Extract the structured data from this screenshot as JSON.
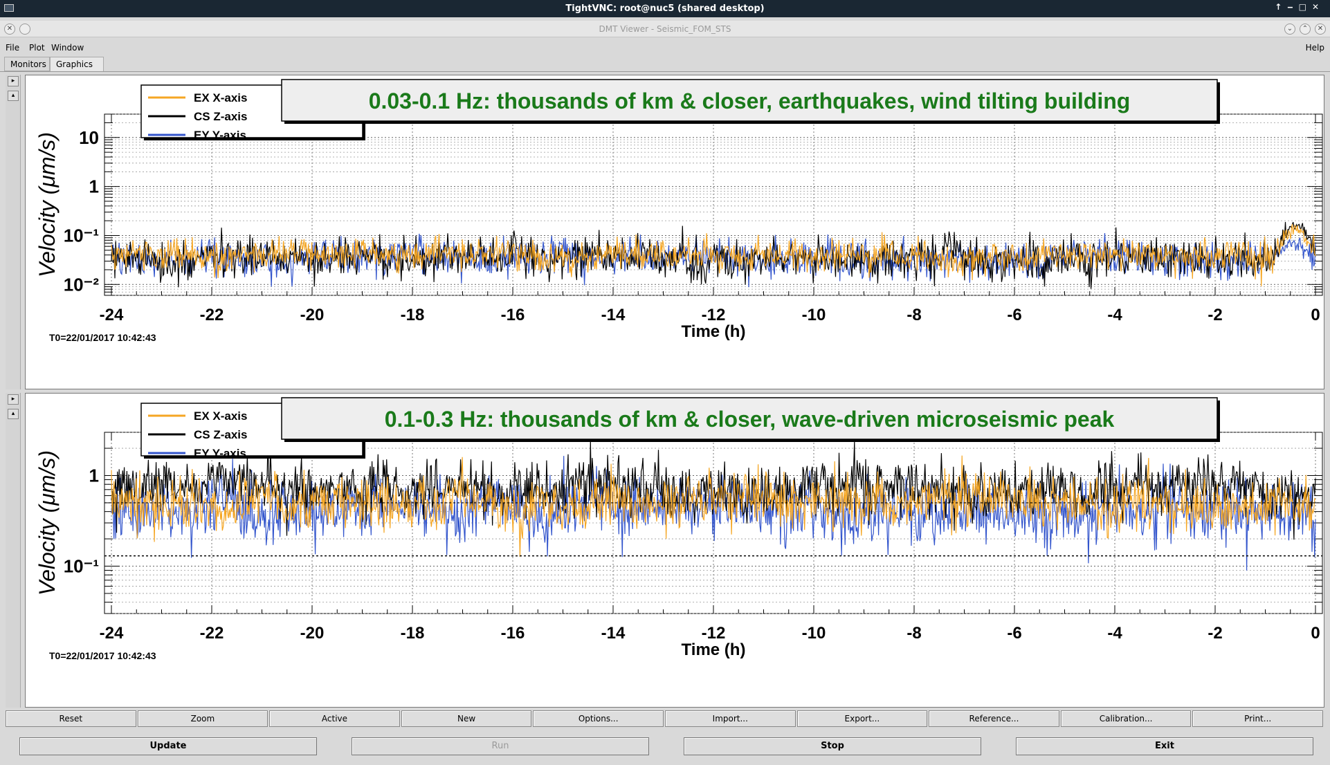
{
  "vnc_title": "TightVNC: root@nuc5 (shared desktop)",
  "app_title": "DMT Viewer - Seismic_FOM_STS",
  "menu": {
    "file": "File",
    "plot": "Plot",
    "window": "Window",
    "help": "Help"
  },
  "tabs": [
    "Monitors",
    "Graphics"
  ],
  "plots": [
    {
      "title": "0.03-0.1 Hz: thousands of km & closer, earthquakes, wind tilting building",
      "ylabel": "Velocity  (μm/s)",
      "xlabel": "Time (h)",
      "t0": "T0=22/01/2017 10:42:43",
      "legend": [
        "EX X-axis",
        "CS Z-axis",
        "EY Y-axis"
      ],
      "yticks": [
        "10",
        "1",
        "10⁻¹",
        "10⁻²"
      ],
      "xticks": [
        "-24",
        "-22",
        "-20",
        "-18",
        "-16",
        "-14",
        "-12",
        "-10",
        "-8",
        "-6",
        "-4",
        "-2",
        "0"
      ]
    },
    {
      "title": "0.1-0.3 Hz: thousands of km & closer, wave-driven microseismic peak",
      "ylabel": "Velocity  (μm/s)",
      "xlabel": "Time (h)",
      "t0": "T0=22/01/2017 10:42:43",
      "legend": [
        "EX X-axis",
        "CS Z-axis",
        "EY Y-axis"
      ],
      "yticks": [
        "1",
        "10⁻¹"
      ],
      "xticks": [
        "-24",
        "-22",
        "-20",
        "-18",
        "-16",
        "-14",
        "-12",
        "-10",
        "-8",
        "-6",
        "-4",
        "-2",
        "0"
      ]
    }
  ],
  "series_colors": {
    "ex": "#f5a623",
    "cs": "#000000",
    "ey": "#3355cc"
  },
  "buttons_row1": [
    "Reset",
    "Zoom",
    "Active",
    "New",
    "Options...",
    "Import...",
    "Export...",
    "Reference...",
    "Calibration...",
    "Print..."
  ],
  "buttons_row2": {
    "update": "Update",
    "run": "Run",
    "stop": "Stop",
    "exit": "Exit"
  },
  "chart_data": [
    {
      "type": "line",
      "title": "0.03-0.1 Hz: thousands of km & closer, earthquakes, wind tilting building",
      "xlabel": "Time (h)",
      "ylabel": "Velocity (μm/s)",
      "yscale": "log",
      "xlim": [
        -24.3,
        0.2
      ],
      "ylim": [
        0.006,
        30
      ],
      "grid": true,
      "legend": "top-left",
      "series": [
        {
          "name": "EX X-axis",
          "level": 0.04,
          "spread": 1.5,
          "peak": 0.16
        },
        {
          "name": "CS Z-axis",
          "level": 0.035,
          "spread": 1.7,
          "peak": 0.18
        },
        {
          "name": "EY Y-axis",
          "level": 0.033,
          "spread": 1.6,
          "peak": 0.08
        }
      ]
    },
    {
      "type": "line",
      "title": "0.1-0.3 Hz: thousands of km & closer, wave-driven microseismic peak",
      "xlabel": "Time (h)",
      "ylabel": "Velocity (μm/s)",
      "yscale": "log",
      "xlim": [
        -24.3,
        0.2
      ],
      "ylim": [
        0.03,
        3
      ],
      "grid": true,
      "legend": "top-left",
      "series": [
        {
          "name": "EX X-axis",
          "level": 0.5,
          "spread": 1.45,
          "peak": 1.0
        },
        {
          "name": "CS Z-axis",
          "level": 0.7,
          "spread": 1.5,
          "peak": 1.6
        },
        {
          "name": "EY Y-axis",
          "level": 0.4,
          "spread": 1.55,
          "peak": 0.6
        }
      ],
      "reference_line": 0.13
    }
  ]
}
